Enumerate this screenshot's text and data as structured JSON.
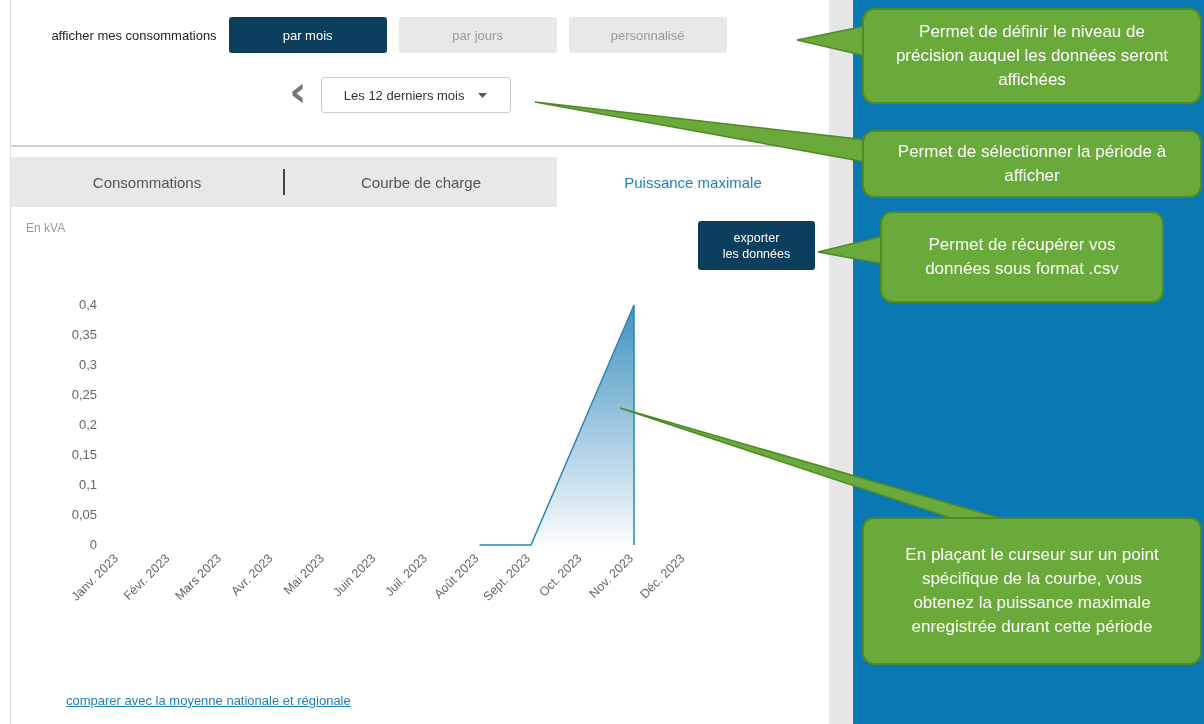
{
  "display": {
    "label": "afficher mes consommations",
    "options": [
      {
        "label": "par mois",
        "selected": true
      },
      {
        "label": "par jours",
        "selected": false
      },
      {
        "label": "personnalisé",
        "selected": false
      }
    ]
  },
  "period": {
    "prev": "‹",
    "value": "Les 12 derniers mois"
  },
  "tabs": [
    {
      "label": "Consommations",
      "selected": false
    },
    {
      "label": "Courbe de charge",
      "selected": false
    },
    {
      "label": "Puissance maximale",
      "selected": true
    }
  ],
  "chart": {
    "unit": "En kVA",
    "export_button": "exporter\nles données",
    "link": "comparer avec la moyenne nationale et régionale",
    "chart_data": {
      "type": "area",
      "categories": [
        "Janv. 2023",
        "Févr. 2023",
        "Mars 2023",
        "Avr. 2023",
        "Mai 2023",
        "Juin 2023",
        "Juil. 2023",
        "Août 2023",
        "Sept. 2023",
        "Oct. 2023",
        "Nov. 2023",
        "Déc. 2023"
      ],
      "series": [
        {
          "color": "#2a86b8",
          "values": [
            null,
            null,
            null,
            null,
            null,
            null,
            null,
            0,
            0,
            0.2,
            0.4,
            null
          ]
        }
      ],
      "ylim": [
        0,
        0.4
      ],
      "yticks": [
        {
          "value": 0,
          "label": "0"
        },
        {
          "value": 0.05,
          "label": "0,05"
        },
        {
          "value": 0.1,
          "label": "0,1"
        },
        {
          "value": 0.15,
          "label": "0,15"
        },
        {
          "value": 0.2,
          "label": "0,2"
        },
        {
          "value": 0.25,
          "label": "0,25"
        },
        {
          "value": 0.3,
          "label": "0,3"
        },
        {
          "value": 0.35,
          "label": "0,35"
        },
        {
          "value": 0.4,
          "label": "0,4"
        }
      ]
    }
  },
  "callouts": [
    {
      "text": "Permet de définir le niveau de précision auquel les données seront affichées"
    },
    {
      "text": "Permet de sélectionner la période à afficher"
    },
    {
      "text": "Permet de récupérer vos données sous format .csv"
    },
    {
      "text": "En plaçant le curseur sur un point spécifique de la courbe, vous obtenez la puissance maximale enregistrée durant cette période"
    }
  ]
}
